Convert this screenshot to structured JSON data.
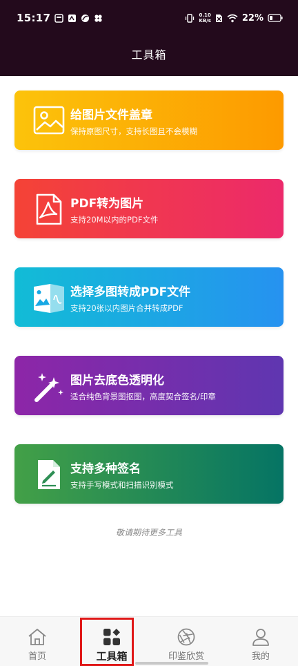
{
  "status_bar": {
    "time": "15:17",
    "net_speed_value": "0.10",
    "net_speed_unit": "KB/s",
    "battery": "22%"
  },
  "header": {
    "title": "工具箱"
  },
  "cards": [
    {
      "title": "给图片文件盖章",
      "subtitle": "保持原图尺寸，支持长图且不会模糊",
      "icon": "image-icon",
      "gradient": [
        "#fcc30b",
        "#fd9a00"
      ]
    },
    {
      "title": "PDF转为图片",
      "subtitle": "支持20M以内的PDF文件",
      "icon": "pdf-file-icon",
      "gradient": [
        "#f44336",
        "#ec2a6b"
      ]
    },
    {
      "title": "选择多图转成PDF文件",
      "subtitle": "支持20张以内图片合并转成PDF",
      "icon": "images-to-pdf-icon",
      "gradient": [
        "#12bcd6",
        "#2692f0"
      ]
    },
    {
      "title": "图片去底色透明化",
      "subtitle": "适合纯色背景图抠图，高度契合签名/印章",
      "icon": "magic-wand-icon",
      "gradient": [
        "#8d26a8",
        "#5f36b0"
      ]
    },
    {
      "title": "支持多种签名",
      "subtitle": "支持手写模式和扫描识别模式",
      "icon": "signature-file-icon",
      "gradient": [
        "#43a047",
        "#057464"
      ]
    }
  ],
  "footer_note": "敬请期待更多工具",
  "tabs": [
    {
      "label": "首页",
      "icon": "home-icon",
      "active": false
    },
    {
      "label": "工具箱",
      "icon": "toolbox-icon",
      "active": true
    },
    {
      "label": "印鉴欣赏",
      "icon": "aperture-icon",
      "active": false
    },
    {
      "label": "我的",
      "icon": "user-icon",
      "active": false
    }
  ],
  "colors": {
    "header_bg": "#230a1c",
    "active_tab": "#222222",
    "inactive_tab": "#777777",
    "highlight": "#e01818"
  }
}
